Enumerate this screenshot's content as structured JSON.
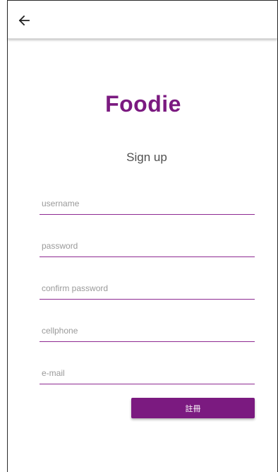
{
  "appbar": {
    "back_icon": "arrow-left-icon"
  },
  "app_title": "Foodie",
  "subtitle": "Sign up",
  "fields": {
    "username_placeholder": "username",
    "password_placeholder": "password",
    "confirm_password_placeholder": "confirm password",
    "cellphone_placeholder": "cellphone",
    "email_placeholder": "e-mail"
  },
  "register_label": "註冊",
  "colors": {
    "accent": "#7b1a80",
    "underline": "#8e2a92"
  }
}
